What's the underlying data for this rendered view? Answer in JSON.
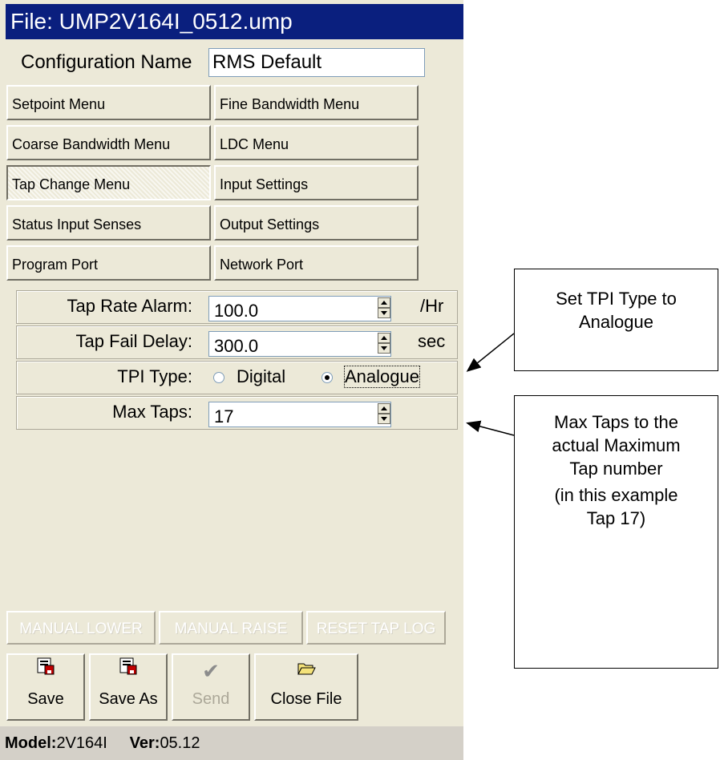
{
  "window": {
    "title": "File: UMP2V164I_0512.ump"
  },
  "config": {
    "label": "Configuration Name",
    "value": "RMS Default"
  },
  "menu": {
    "setpoint": "Setpoint Menu",
    "fine_bandwidth": "Fine Bandwidth Menu",
    "coarse_bandwidth": "Coarse Bandwidth Menu",
    "ldc": "LDC Menu",
    "tap_change": "Tap Change Menu",
    "input_settings": "Input Settings",
    "status_input_senses": "Status Input Senses",
    "output_settings": "Output Settings",
    "program_port": "Program Port",
    "network_port": "Network Port"
  },
  "fields": {
    "tap_rate_alarm": {
      "label": "Tap Rate Alarm:",
      "value": "100.0",
      "unit": "/Hr"
    },
    "tap_fail_delay": {
      "label": "Tap Fail Delay:",
      "value": "300.0",
      "unit": "sec"
    },
    "tpi_type": {
      "label": "TPI Type:",
      "options": [
        "Digital",
        "Analogue"
      ],
      "selected": "Analogue"
    },
    "max_taps": {
      "label": "Max Taps:",
      "value": "17"
    }
  },
  "actions": {
    "manual_lower": "MANUAL LOWER",
    "manual_raise": "MANUAL RAISE",
    "reset_tap_log": "RESET TAP LOG"
  },
  "toolbar": {
    "save": "Save",
    "save_as": "Save As",
    "send": "Send",
    "close_file": "Close File",
    "icons": {
      "save": "save-disk-icon",
      "save_as": "save-as-disk-icon",
      "send": "checkmark-icon",
      "close_file": "folder-icon"
    }
  },
  "status": {
    "model_label": "Model:",
    "model_value": "2V164I",
    "ver_label": "Ver:",
    "ver_value": "05.12"
  },
  "callouts": {
    "tpi": [
      "Set TPI Type to",
      "Analogue"
    ],
    "max_taps": [
      "Max Taps to the",
      "actual Maximum",
      "Tap number",
      "(in this example",
      "Tap 17)"
    ]
  },
  "colors": {
    "title_bar": "#0a1f7e",
    "window_bg": "#ece9d8",
    "status_bg": "#d4d0c8"
  }
}
